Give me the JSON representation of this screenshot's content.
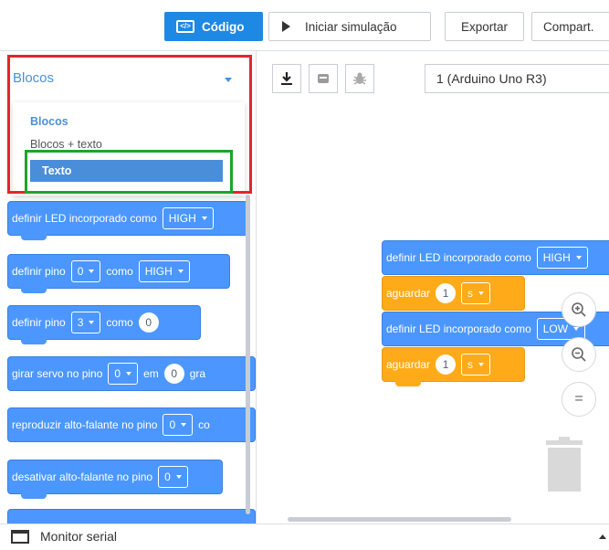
{
  "toolbar": {
    "code_label": "Código",
    "code_icon_text": "</>",
    "simulate_label": "Iniciar simulação",
    "export_label": "Exportar",
    "share_label": "Compart."
  },
  "blocks_panel": {
    "selected_mode": "Blocos",
    "menu_items": [
      "Blocos",
      "Blocos + texto",
      "Texto"
    ],
    "highlighted_item": "Texto",
    "highlight_colors": {
      "red_box": "#e5252c",
      "green_box": "#1fa32c"
    },
    "palette": [
      {
        "text": "definir LED incorporado como",
        "value": "HIGH"
      },
      {
        "text": "definir pino",
        "pin": "0",
        "mid": "como",
        "value": "HIGH"
      },
      {
        "text": "definir pino",
        "pin": "3",
        "mid": "como",
        "value": "0"
      },
      {
        "text": "girar servo no pino",
        "pin": "0",
        "mid": "em",
        "value": "0",
        "tail": "gra"
      },
      {
        "text": "reproduzir alto-falante no pino",
        "pin": "0",
        "tail": "co"
      },
      {
        "text": "desativar alto-falante no pino",
        "pin": "0"
      }
    ]
  },
  "canvas": {
    "board_select": "1 (Arduino Uno R3)",
    "tool_icons": [
      "download-icon",
      "component-icon",
      "debug-bug-icon"
    ],
    "script": [
      {
        "type": "action",
        "text": "definir LED incorporado como",
        "value": "HIGH"
      },
      {
        "type": "wait",
        "text": "aguardar",
        "value": "1",
        "unit": "s"
      },
      {
        "type": "action",
        "text": "definir LED incorporado como",
        "value": "LOW"
      },
      {
        "type": "wait",
        "text": "aguardar",
        "value": "1",
        "unit": "s"
      }
    ],
    "zoom": {
      "in_symbol": "+",
      "out_symbol": "−",
      "reset_symbol": "="
    }
  },
  "footer": {
    "serial_monitor_label": "Monitor serial"
  },
  "colors": {
    "accent": "#1e88e5",
    "block_blue": "#4c97ff",
    "block_orange": "#ffab19"
  }
}
